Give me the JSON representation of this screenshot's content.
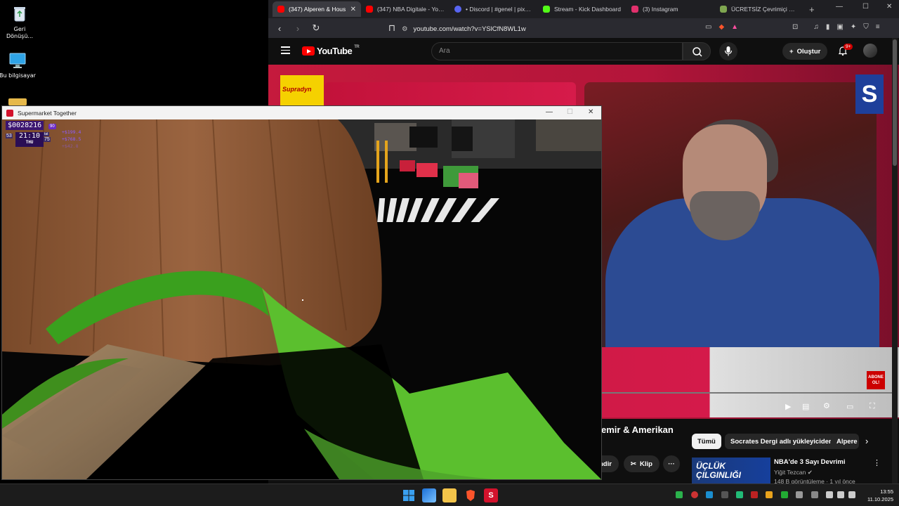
{
  "desktop": {
    "icons": [
      {
        "label": "Geri Dönüşü...",
        "icon": "recycle-bin-icon"
      },
      {
        "label": "Bu bilgisayar",
        "icon": "computer-icon"
      }
    ]
  },
  "browser": {
    "tabs": [
      {
        "title": "(347) Alperen & Hous",
        "active": true,
        "color": "#ff0000"
      },
      {
        "title": "(347) NBA Digitale - YouT",
        "active": false,
        "color": "#ff0000"
      },
      {
        "title": "• Discord | #genel | pixme",
        "active": false,
        "color": "#5865f2"
      },
      {
        "title": "Stream - Kick Dashboard",
        "active": false,
        "color": "#53fc18"
      },
      {
        "title": "(3) Instagram",
        "active": false,
        "color": "#e1306c"
      },
      {
        "title": "ÜCRETSİZ Çevrimiçi Satran",
        "active": false,
        "color": "#7fa650"
      }
    ],
    "url": "youtube.com/watch?v=YSlCfN8WL1w"
  },
  "youtube": {
    "logo_text": "YouTube",
    "region": "TR",
    "search_placeholder": "Ara",
    "create_label": "Oluştur",
    "notifications": "9+",
    "sponsor_label": "Supradyn",
    "channel_logo": "S",
    "subscribe_badge": "ABONE OL!",
    "video_title": "emir & Amerikan",
    "chips": [
      "Tümü",
      "Socrates Dergi adlı yükleyiciden",
      "Alpere"
    ],
    "actions": {
      "download": "ndir",
      "clip": "Klip"
    },
    "recommendation": {
      "thumb_text": "ÜÇLÜK ÇILGINLIĞI",
      "title": "NBA'de 3 Sayı Devrimi",
      "channel": "Yiğit Tezcan",
      "meta": "148 B görüntüleme · 1 yıl önce"
    }
  },
  "game": {
    "window_title": "Supermarket Together",
    "money": "$0028216",
    "level": "90",
    "time": "21:10",
    "day": "THU",
    "left_stat": "53",
    "right_stat_top": "tat",
    "right_stat": "75",
    "gains": [
      "+$199.4",
      "+$768.5",
      "+$42.8"
    ]
  },
  "taskbar": {
    "time": "13:55",
    "date": "11.10.2025"
  }
}
